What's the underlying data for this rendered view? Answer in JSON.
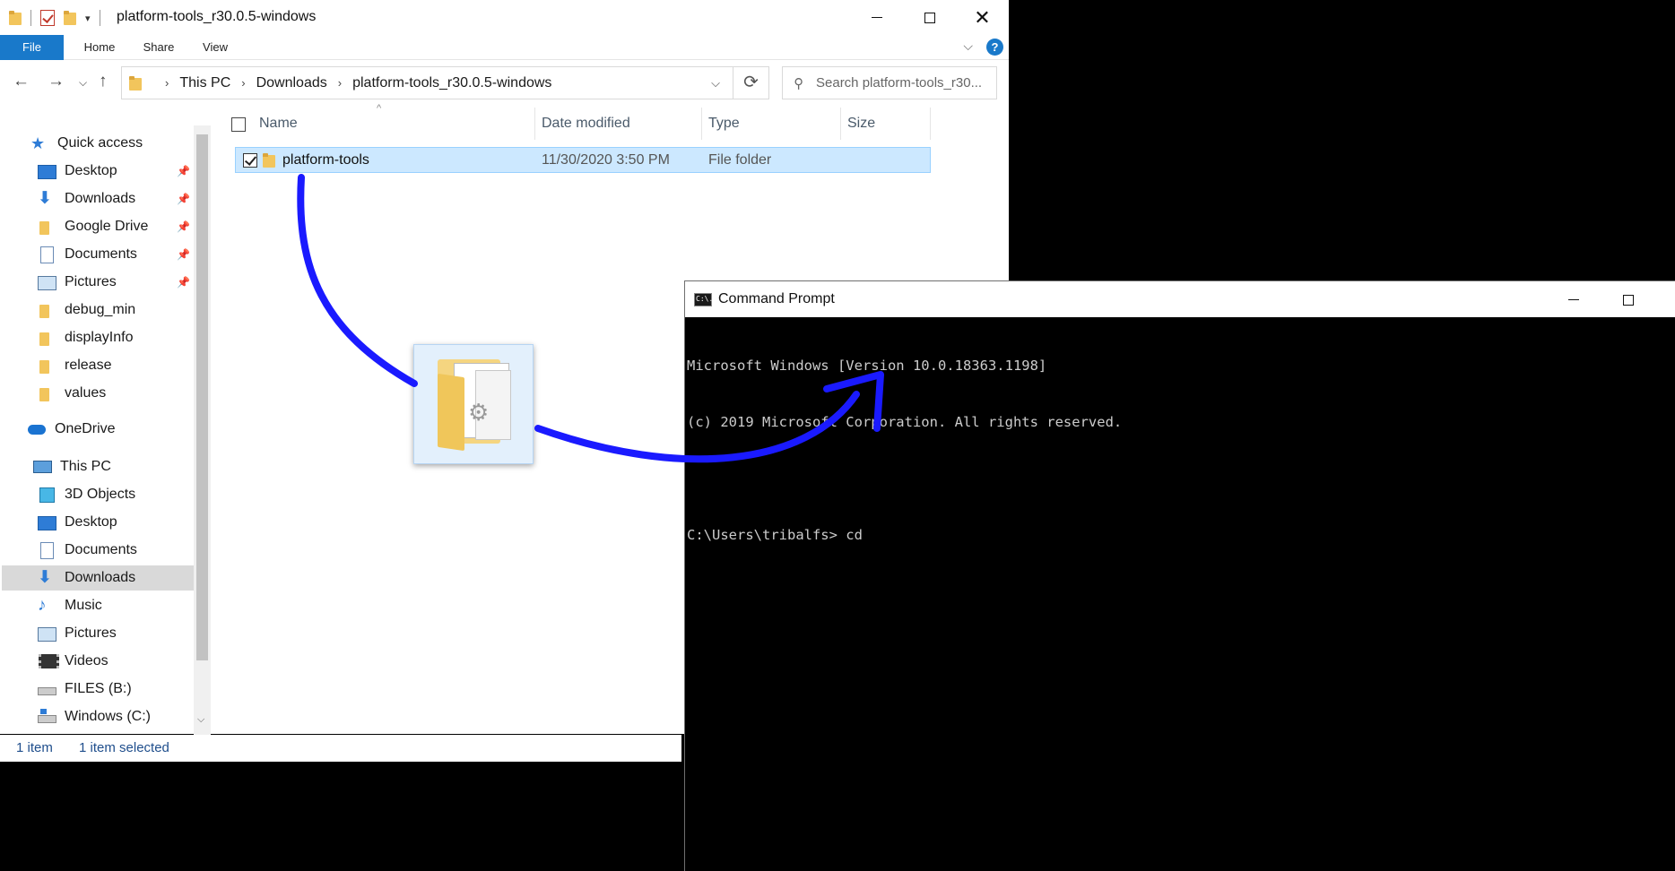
{
  "explorer": {
    "title": "platform-tools_r30.0.5-windows",
    "ribbon": {
      "file": "File",
      "home": "Home",
      "share": "Share",
      "view": "View",
      "help": "?"
    },
    "breadcrumb": [
      "This PC",
      "Downloads",
      "platform-tools_r30.0.5-windows"
    ],
    "search_placeholder": "Search platform-tools_r30...",
    "columns": {
      "name": "Name",
      "date": "Date modified",
      "type": "Type",
      "size": "Size"
    },
    "files": [
      {
        "name": "platform-tools",
        "date": "11/30/2020 3:50 PM",
        "type": "File folder",
        "size": ""
      }
    ],
    "nav": {
      "quick_access": "Quick access",
      "pinned": [
        "Desktop",
        "Downloads",
        "Google Drive",
        "Documents",
        "Pictures"
      ],
      "recent": [
        "debug_min",
        "displayInfo",
        "release",
        "values"
      ],
      "onedrive": "OneDrive",
      "this_pc": "This PC",
      "pc_items": [
        "3D Objects",
        "Desktop",
        "Documents",
        "Downloads",
        "Music",
        "Pictures",
        "Videos",
        "FILES (B:)",
        "Windows (C:)"
      ]
    },
    "status": {
      "count": "1 item",
      "selected": "1 item selected"
    }
  },
  "cmd": {
    "title": "Command Prompt",
    "icon_text": "C:\\.",
    "lines": [
      "Microsoft Windows [Version 10.0.18363.1198]",
      "(c) 2019 Microsoft Corporation. All rights reserved.",
      "",
      "C:\\Users\\tribalfs> cd"
    ]
  },
  "annotation": {
    "arrow_color": "#1a1aff"
  }
}
